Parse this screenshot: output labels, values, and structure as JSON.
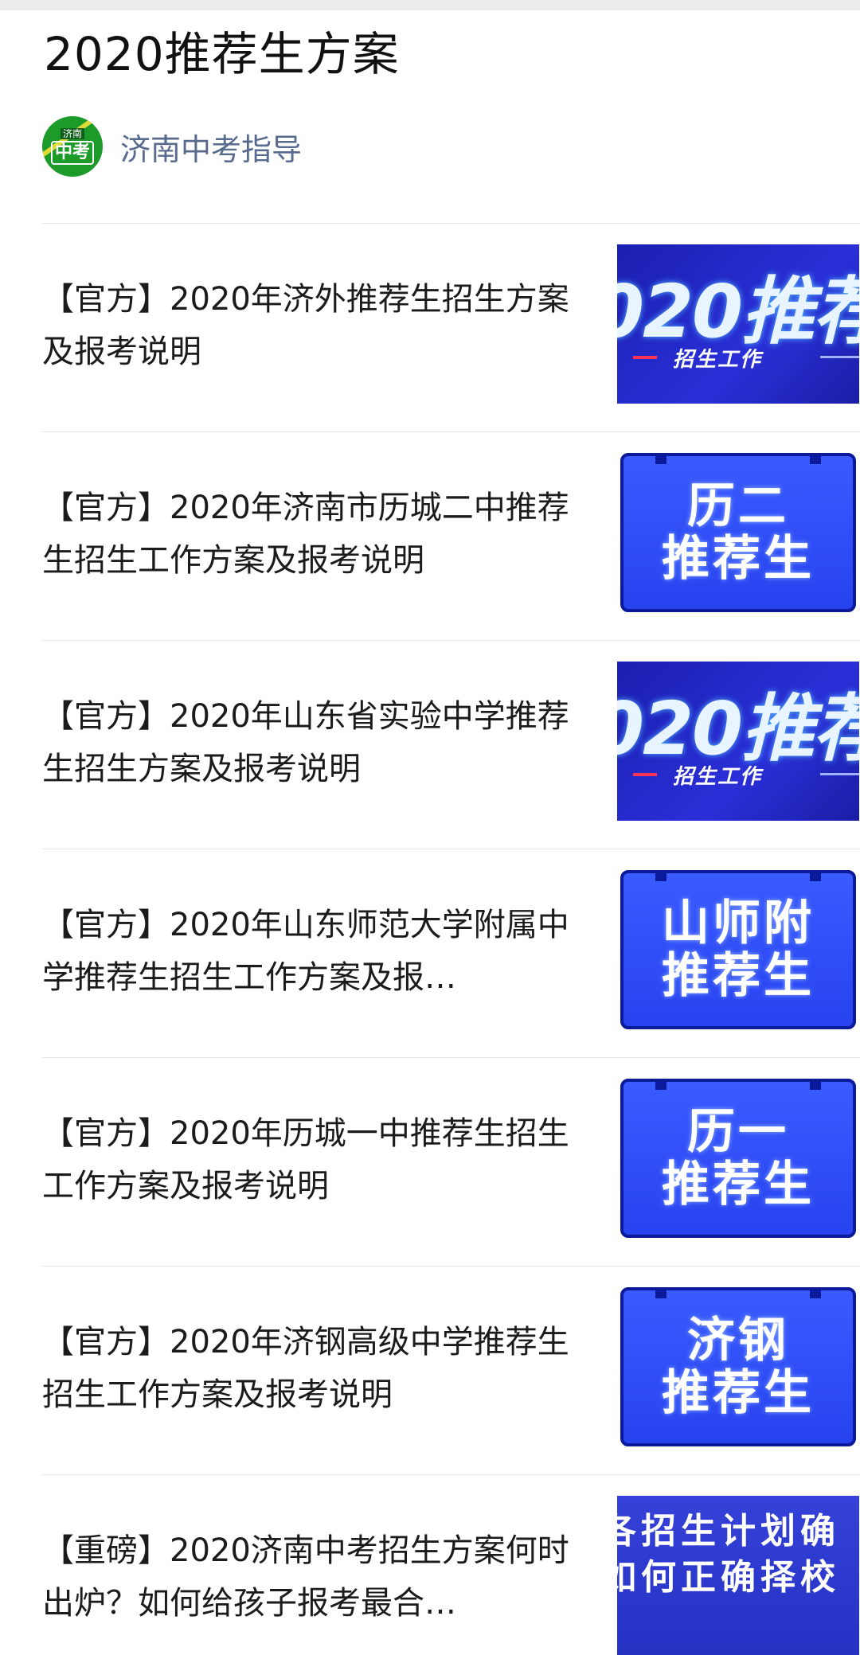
{
  "page": {
    "title": "2020推荐生方案"
  },
  "account": {
    "avatar_small": "济南",
    "avatar_big": "中考",
    "name": "济南中考指导"
  },
  "articles": [
    {
      "title": "【官方】2020年济外推荐生招生方案及报考说明",
      "thumb": {
        "style": "banner",
        "big": "020推荐",
        "sub": "招生工作"
      }
    },
    {
      "title": "【官方】2020年济南市历城二中推荐生招生工作方案及报考说明",
      "thumb": {
        "style": "blue-box",
        "line1": "历二",
        "line2": "推荐生"
      }
    },
    {
      "title": "【官方】2020年山东省实验中学推荐生招生方案及报考说明",
      "thumb": {
        "style": "banner",
        "big": "020推荐",
        "sub": "招生工作"
      }
    },
    {
      "title": "【官方】2020年山东师范大学附属中学推荐生招生工作方案及报…",
      "thumb": {
        "style": "blue-box",
        "line1": "山师附",
        "line2": "推荐生"
      }
    },
    {
      "title": "【官方】2020年历城一中推荐生招生工作方案及报考说明",
      "thumb": {
        "style": "blue-box",
        "line1": "历一",
        "line2": "推荐生"
      }
    },
    {
      "title": "【官方】2020年济钢高级中学推荐生招生工作方案及报考说明",
      "thumb": {
        "style": "blue-box",
        "line1": "济钢",
        "line2": "推荐生"
      }
    },
    {
      "title": "【重磅】2020济南中考招生方案何时出炉？如何给孩子报考最合…",
      "thumb": {
        "style": "strip",
        "r1": "各招生计划确",
        "r2": "如何正确择校"
      }
    }
  ]
}
